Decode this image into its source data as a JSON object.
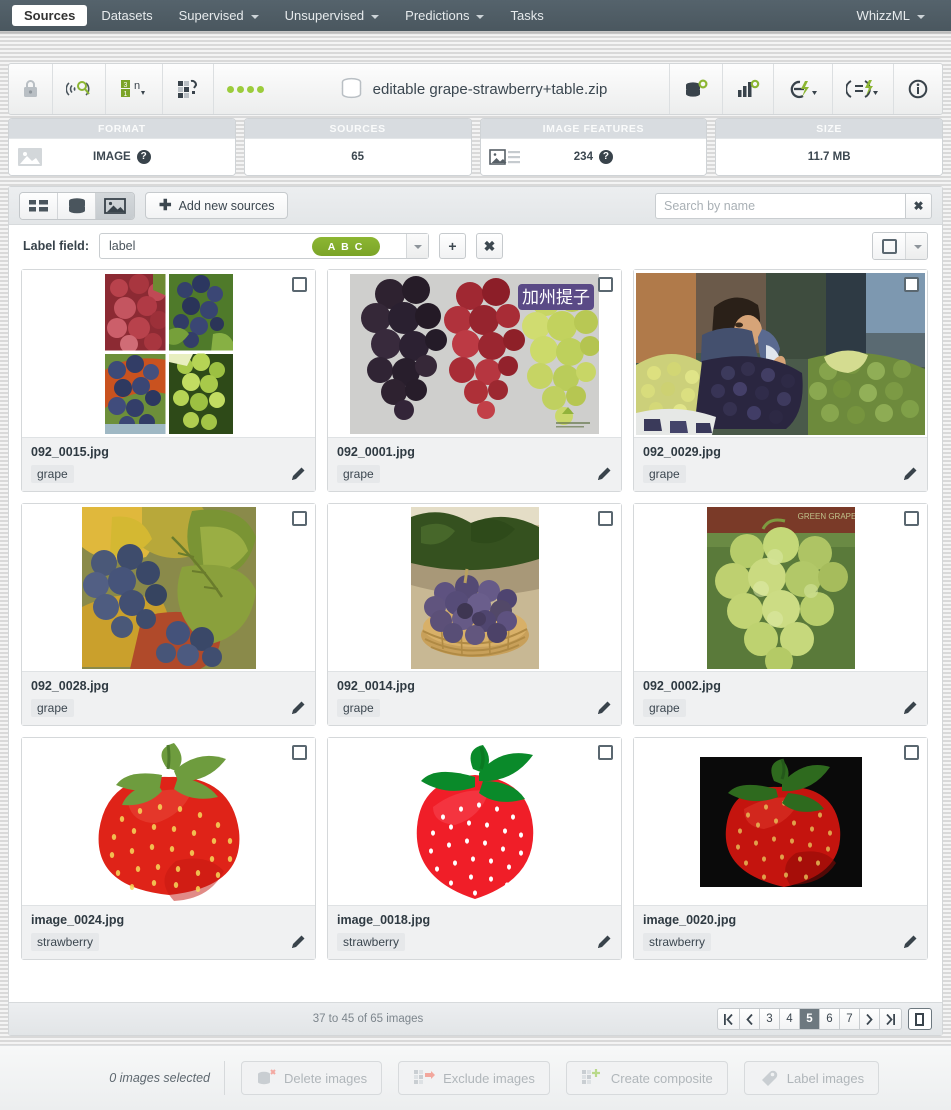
{
  "topnav": {
    "items": [
      {
        "label": "Sources",
        "active": true,
        "caret": false
      },
      {
        "label": "Datasets",
        "active": false,
        "caret": false
      },
      {
        "label": "Supervised",
        "active": false,
        "caret": true
      },
      {
        "label": "Unsupervised",
        "active": false,
        "caret": true
      },
      {
        "label": "Predictions",
        "active": false,
        "caret": true
      },
      {
        "label": "Tasks",
        "active": false,
        "caret": false
      }
    ],
    "right_label": "WhizzML"
  },
  "titlebar": {
    "title": "editable grape-strawberry+table.zip",
    "status_dots": 4,
    "left_icons": [
      "lock-icon",
      "wifi-search-icon",
      "field-types-icon",
      "composite-icon"
    ],
    "right_icons": [
      "dataset-gear-icon",
      "chart-gear-icon",
      "batch-flash-icon",
      "script-flash-icon",
      "info-icon"
    ]
  },
  "stats": [
    {
      "header": "FORMAT",
      "value": "IMAGE",
      "icon": "image-icon",
      "help": true
    },
    {
      "header": "SOURCES",
      "value": "65",
      "icon": null,
      "help": false
    },
    {
      "header": "IMAGE FEATURES",
      "value": "234",
      "icon": "image-list-icon",
      "help": true
    },
    {
      "header": "SIZE",
      "value": "11.7 MB",
      "icon": null,
      "help": false
    }
  ],
  "toolbar": {
    "views": [
      {
        "name": "list-view",
        "icon": "list-icon",
        "selected": false
      },
      {
        "name": "sources-view",
        "icon": "database-icon",
        "selected": false
      },
      {
        "name": "image-view",
        "icon": "picture-icon",
        "selected": true
      }
    ],
    "add_sources_label": "Add new sources",
    "search_placeholder": "Search by name",
    "search_value": ""
  },
  "label_field": {
    "label": "Label field:",
    "value": "label",
    "badge": "A B C",
    "add_label": "+",
    "remove_label": "✖"
  },
  "grid": {
    "cards": [
      {
        "filename": "092_0015.jpg",
        "tag": "grape",
        "image": "grape-collage-4panel",
        "checked": false
      },
      {
        "filename": "092_0001.jpg",
        "tag": "grape",
        "image": "grape-poster-three-bunches",
        "checked": false
      },
      {
        "filename": "092_0029.jpg",
        "tag": "grape",
        "image": "grape-market-vendor",
        "checked": false
      },
      {
        "filename": "092_0028.jpg",
        "tag": "grape",
        "image": "grape-autumn-leaves",
        "checked": false
      },
      {
        "filename": "092_0014.jpg",
        "tag": "grape",
        "image": "grape-basket-vineyard",
        "checked": false
      },
      {
        "filename": "092_0002.jpg",
        "tag": "grape",
        "image": "green-grape-bunch",
        "checked": false
      },
      {
        "filename": "image_0024.jpg",
        "tag": "strawberry",
        "image": "strawberry-photo-white",
        "checked": false
      },
      {
        "filename": "image_0018.jpg",
        "tag": "strawberry",
        "image": "strawberry-illustration",
        "checked": false
      },
      {
        "filename": "image_0020.jpg",
        "tag": "strawberry",
        "image": "strawberry-dark-bg",
        "checked": false
      }
    ]
  },
  "pager": {
    "count_text": "37 to 45 of 65 images",
    "first": "|❬",
    "prev": "❬",
    "next": "❭",
    "last": "❭|",
    "pages": [
      "3",
      "4",
      "5",
      "6",
      "7"
    ],
    "current": "5"
  },
  "actions": {
    "selected_text": "0 images selected",
    "buttons": [
      {
        "label": "Delete images",
        "icon": "delete-source-icon"
      },
      {
        "label": "Exclude images",
        "icon": "exclude-icon"
      },
      {
        "label": "Create composite",
        "icon": "composite-plus-icon"
      },
      {
        "label": "Label images",
        "icon": "tag-icon"
      }
    ]
  },
  "colors": {
    "nav_bg": "#4a575f",
    "accent_green": "#7ba428",
    "status_dot": "#9ccc3c",
    "selected_page": "#6d787f"
  }
}
